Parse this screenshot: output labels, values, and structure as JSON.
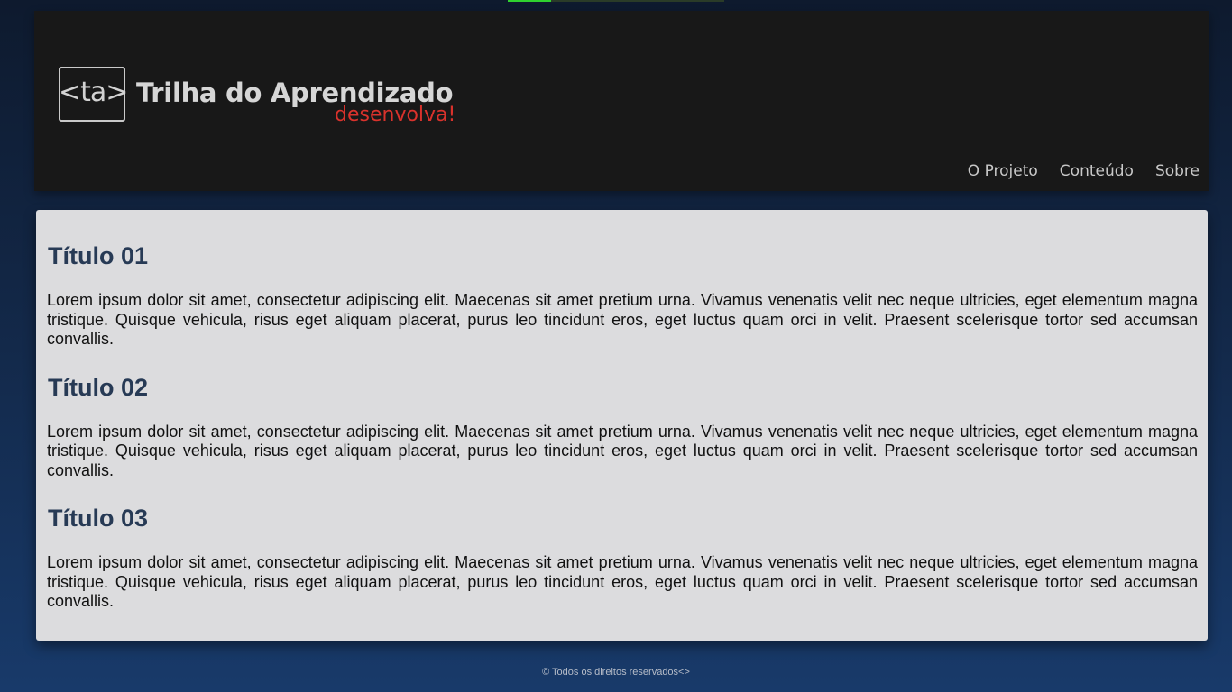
{
  "header": {
    "logo": {
      "box_text": "<ta>",
      "name": "Trilha do Aprendizado",
      "tagline": "desenvolva!"
    },
    "nav": [
      {
        "label": "O Projeto"
      },
      {
        "label": "Conteúdo"
      },
      {
        "label": "Sobre"
      }
    ]
  },
  "main": {
    "sections": [
      {
        "title": "Título 01",
        "text": "Lorem ipsum dolor sit amet, consectetur adipiscing elit. Maecenas sit amet pretium urna. Vivamus venenatis velit nec neque ultricies, eget elementum magna tristique. Quisque vehicula, risus eget aliquam placerat, purus leo tincidunt eros, eget luctus quam orci in velit. Praesent scelerisque tortor sed accumsan convallis."
      },
      {
        "title": "Título 02",
        "text": "Lorem ipsum dolor sit amet, consectetur adipiscing elit. Maecenas sit amet pretium urna. Vivamus venenatis velit nec neque ultricies, eget elementum magna tristique. Quisque vehicula, risus eget aliquam placerat, purus leo tincidunt eros, eget luctus quam orci in velit. Praesent scelerisque tortor sed accumsan convallis."
      },
      {
        "title": "Título 03",
        "text": "Lorem ipsum dolor sit amet, consectetur adipiscing elit. Maecenas sit amet pretium urna. Vivamus venenatis velit nec neque ultricies, eget elementum magna tristique. Quisque vehicula, risus eget aliquam placerat, purus leo tincidunt eros, eget luctus quam orci in velit. Praesent scelerisque tortor sed accumsan convallis."
      }
    ]
  },
  "footer": {
    "text": "© Todos os direitos reservados<>"
  },
  "colors": {
    "background_top": "#0e1a2e",
    "background_bottom": "#183a6a",
    "header_bg": "#181818",
    "content_bg": "#dcdcde",
    "heading": "#273a55",
    "tagline": "#d9322c"
  }
}
